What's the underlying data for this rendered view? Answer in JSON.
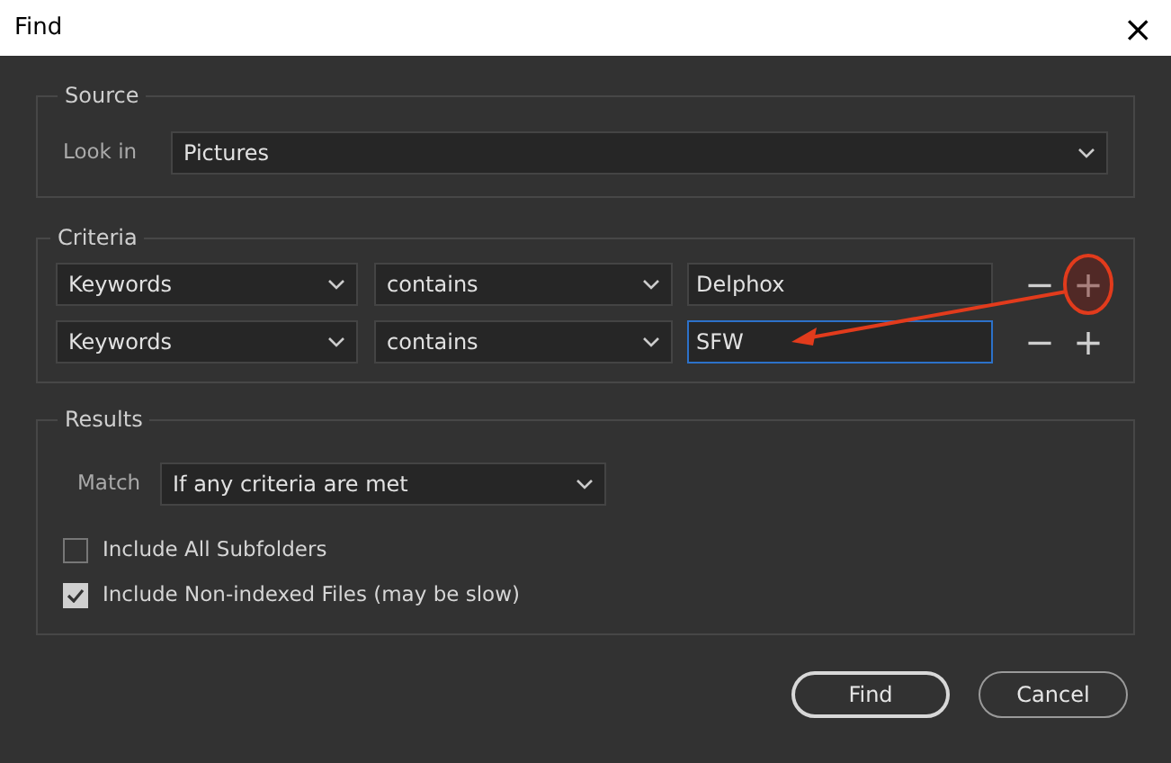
{
  "window": {
    "title": "Find",
    "close": "×"
  },
  "source": {
    "legend": "Source",
    "look_in_label": "Look in",
    "look_in_value": "Pictures"
  },
  "criteria": {
    "legend": "Criteria",
    "rows": [
      {
        "field": "Keywords",
        "operator": "contains",
        "value": "Delphox",
        "remove": "−",
        "add": "+",
        "focused": false,
        "annotated": true
      },
      {
        "field": "Keywords",
        "operator": "contains",
        "value": "SFW",
        "remove": "−",
        "add": "+",
        "focused": true,
        "annotated": false
      }
    ]
  },
  "results": {
    "legend": "Results",
    "match_label": "Match",
    "match_value": "If any criteria are met",
    "options": [
      {
        "label": "Include All Subfolders",
        "checked": false
      },
      {
        "label": "Include Non-indexed Files (may be slow)",
        "checked": true
      }
    ]
  },
  "buttons": [
    {
      "label": "Find",
      "default": true
    },
    {
      "label": "Cancel",
      "default": false
    }
  ]
}
